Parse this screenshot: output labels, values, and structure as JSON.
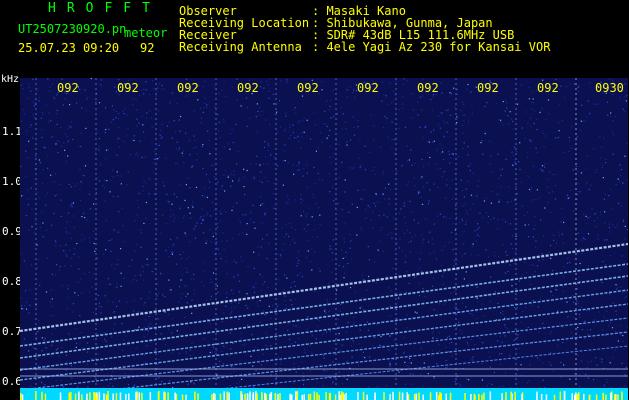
{
  "brand": "HROFFT",
  "file": {
    "name": "UT2507230920.pn",
    "type": "meteor",
    "datetime": "25.07.23 09:20",
    "number": "92"
  },
  "header": [
    {
      "label": "Observer",
      "value": ": Masaki Kano"
    },
    {
      "label": "Receiving Location",
      "value": ": Shibukawa, Gunma, Japan"
    },
    {
      "label": "Receiver",
      "value": ": SDR# 43dB L15 111.6MHz USB"
    },
    {
      "label": "Receiving Antenna",
      "value": ": 4ele Yagi Az 230 for Kansai VOR"
    }
  ],
  "axis": {
    "unit": "kHz",
    "ticks": [
      "1.1",
      "1.0",
      "0.9",
      "0.8",
      "0.7",
      "0.6"
    ]
  },
  "time_labels": [
    "092",
    "092",
    "092",
    "092",
    "092",
    "092",
    "092",
    "092",
    "092",
    "0930"
  ],
  "colors": {
    "background": "#000000",
    "spectrogram": "#0a1050",
    "signal": "#a0d0ff",
    "marker": "#ffff00",
    "text": "#ffffff",
    "title": "#00ff00"
  }
}
